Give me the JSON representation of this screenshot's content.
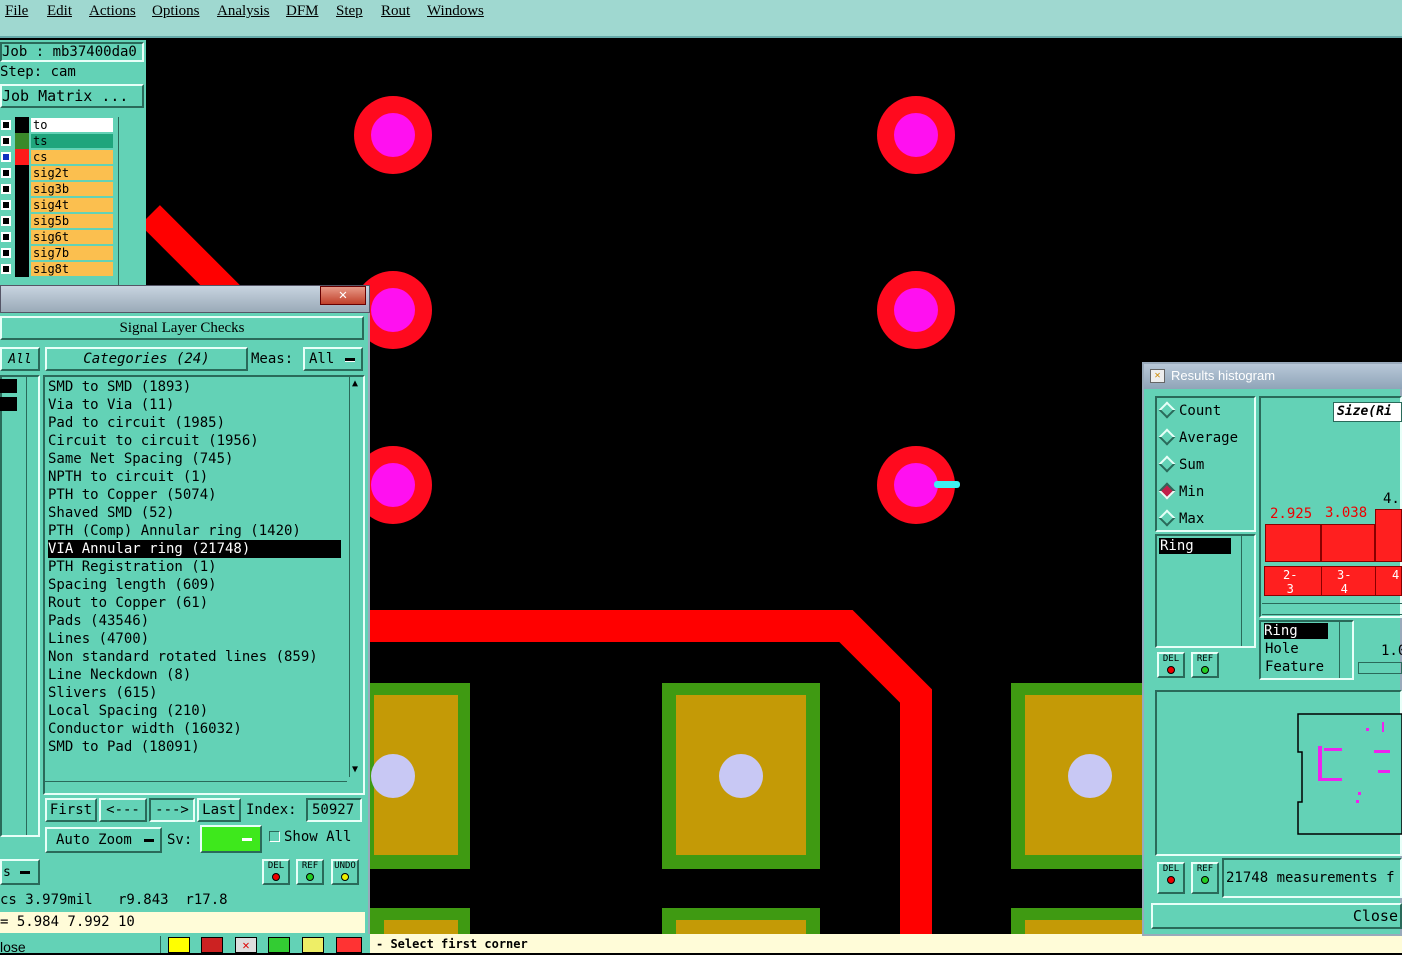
{
  "menu": [
    "File",
    "Edit",
    "Actions",
    "Options",
    "Analysis",
    "DFM",
    "Step",
    "Rout",
    "Windows"
  ],
  "job": {
    "job_label": "Job : mb37400da0",
    "step_label": "Step: cam",
    "matrix_button": "Job Matrix ..."
  },
  "layers": [
    {
      "name": "to",
      "color": "#000000",
      "bg": "#ffffff"
    },
    {
      "name": "ts",
      "color": "#3a8a2a",
      "bg": "#1fa57c"
    },
    {
      "name": "cs",
      "color": "#ff1a1a",
      "bg": "#fbbf4f"
    },
    {
      "name": "sig2t",
      "color": "#000000",
      "bg": "#fbbf4f"
    },
    {
      "name": "sig3b",
      "color": "#000000",
      "bg": "#fbbf4f"
    },
    {
      "name": "sig4t",
      "color": "#000000",
      "bg": "#fbbf4f"
    },
    {
      "name": "sig5b",
      "color": "#000000",
      "bg": "#fbbf4f"
    },
    {
      "name": "sig6t",
      "color": "#000000",
      "bg": "#fbbf4f"
    },
    {
      "name": "sig7b",
      "color": "#000000",
      "bg": "#fbbf4f"
    },
    {
      "name": "sig8t",
      "color": "#000000",
      "bg": "#fbbf4f"
    }
  ],
  "checks": {
    "title": "Signal Layer Checks",
    "all_button": "All",
    "categories_label": "Categories (24)",
    "meas_label": "Meas:",
    "meas_value": "All",
    "items": [
      "SMD to SMD (1893)",
      "Via to Via (11)",
      "Pad to circuit (1985)",
      "Circuit to circuit (1956)",
      "Same Net Spacing (745)",
      "NPTH to circuit (1)",
      "PTH to Copper (5074)",
      "Shaved SMD (52)",
      "PTH (Comp) Annular ring (1420)",
      "VIA Annular ring (21748)",
      "PTH Registration (1)",
      "Spacing length (609)",
      "Rout to Copper (61)",
      "Pads (43546)",
      "Lines (4700)",
      "Non standard rotated lines (859)",
      "Line Neckdown (8)",
      "Slivers (615)",
      "Local Spacing (210)",
      "Conductor width (16032)",
      "SMD to Pad (18091)"
    ],
    "selected_index": 9,
    "first": "First",
    "prev": "<---",
    "next": "--->",
    "last": "Last",
    "index_label": "Index:",
    "index_value": "50927",
    "zoom_value": "Auto Zoom",
    "sv_label": "Sv:",
    "show_all": "Show All",
    "del": "DEL",
    "ref": "REF",
    "undo": "UNDO",
    "side_dropdown": "s"
  },
  "status": {
    "line1": "cs 3.979mil   r9.843  r17.8",
    "line2": "= 5.984 7.992 10",
    "close": "lose",
    "prompt": "- Select first corner"
  },
  "histogram": {
    "title": "Results histogram",
    "modes": [
      "Count",
      "Average",
      "Sum",
      "Min",
      "Max"
    ],
    "selected_mode": "Min",
    "size_label": "Size(Ri",
    "bar_labels": [
      "2.925",
      "3.038",
      "4."
    ],
    "bins": [
      "2-\n3",
      "3-\n4",
      "4"
    ],
    "list_selected": "Ring",
    "attr_items": [
      "Ring",
      "Hole",
      "Feature"
    ],
    "scale_value": "1.0",
    "del": "DEL",
    "ref": "REF",
    "measurements": "21748 measurements f",
    "close": "Close"
  }
}
